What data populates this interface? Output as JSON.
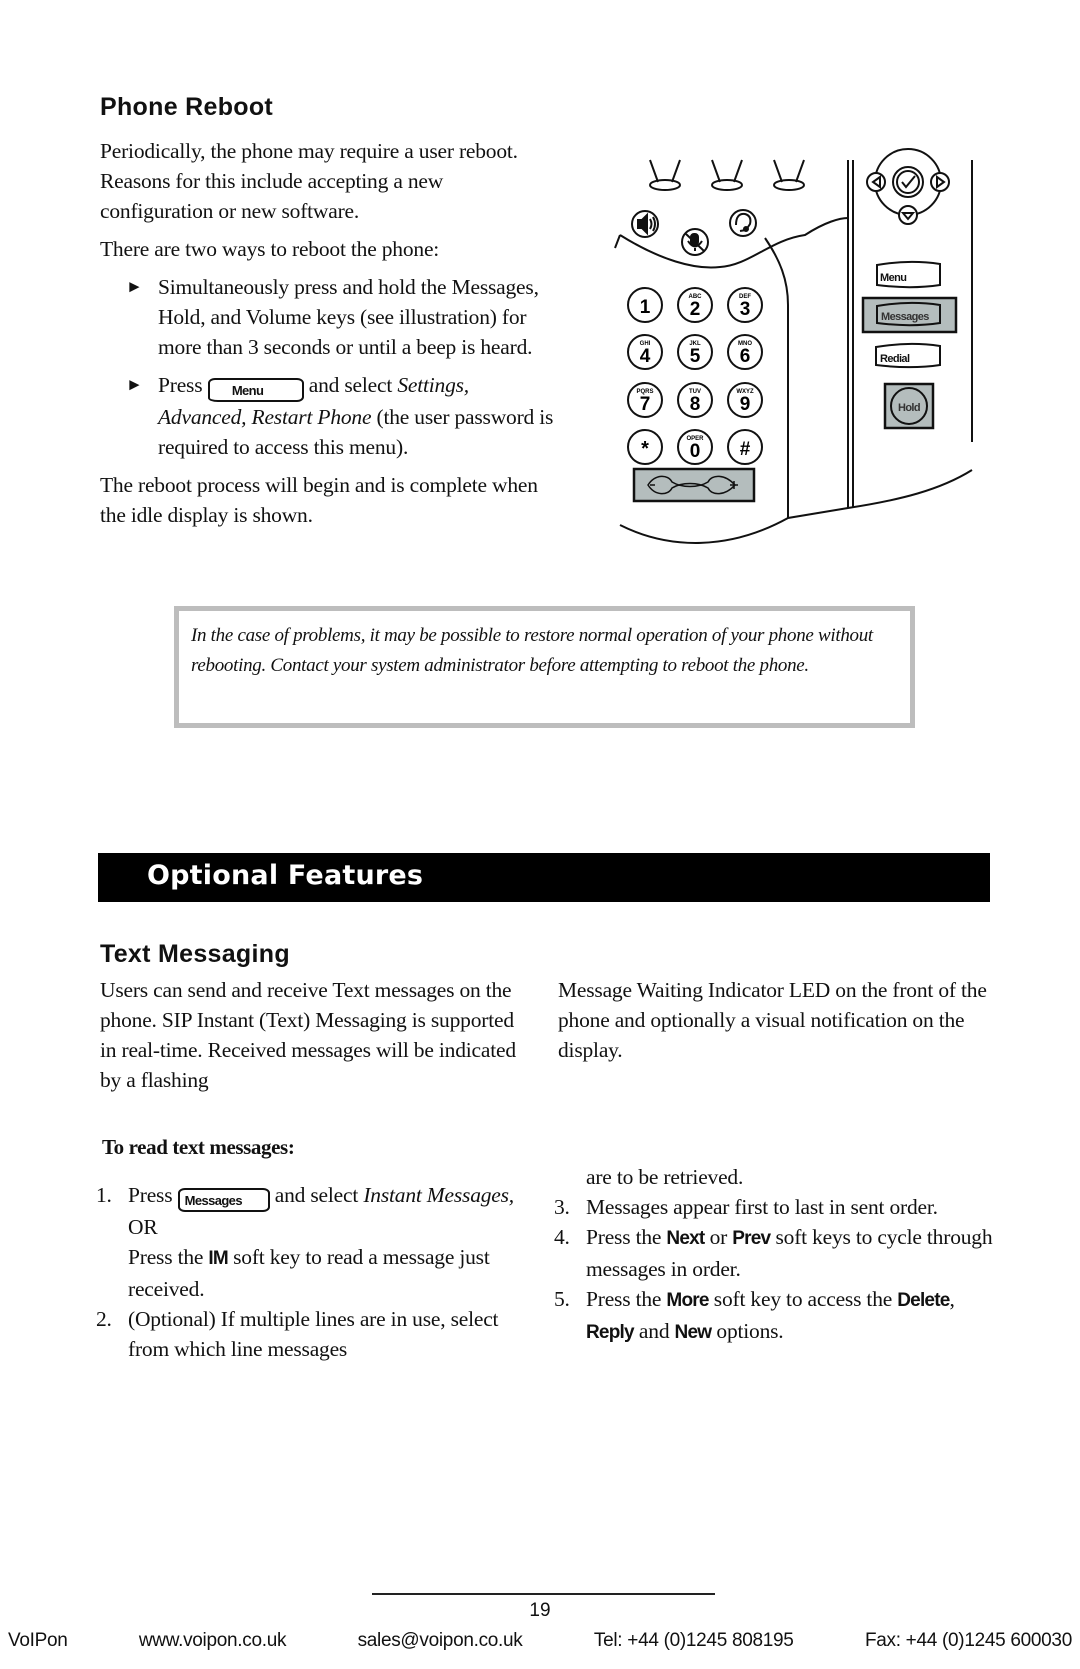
{
  "phone_reboot": {
    "heading": "Phone Reboot",
    "intro_1": "Periodically, the phone may require a user reboot.  Reasons for this include accepting a new configuration or new software.",
    "intro_2": "There are two ways to reboot the phone:",
    "bullet_glyph": "►",
    "bullet_1": "Simultaneously press and hold the Messages, Hold, and Volume keys (see illustration) for more than 3 seconds or until a beep is heard.",
    "bullet_2": {
      "press": "Press",
      "key_label": "Menu",
      "after_key": " and select ",
      "path_italic": "Settings, Advanced, Restart Phone",
      "rest": " (the user password is required to access this menu)."
    },
    "outro": "The reboot process will begin and is complete when the idle display is shown."
  },
  "phone_illustration": {
    "keypad": [
      {
        "digit": "1",
        "letters": ""
      },
      {
        "digit": "2",
        "letters": "ABC"
      },
      {
        "digit": "3",
        "letters": "DEF"
      },
      {
        "digit": "4",
        "letters": "GHI"
      },
      {
        "digit": "5",
        "letters": "JKL"
      },
      {
        "digit": "6",
        "letters": "MNO"
      },
      {
        "digit": "7",
        "letters": "PQRS"
      },
      {
        "digit": "8",
        "letters": "TUV"
      },
      {
        "digit": "9",
        "letters": "WXYZ"
      },
      {
        "digit": "*",
        "letters": ""
      },
      {
        "digit": "0",
        "letters": "OPER"
      },
      {
        "digit": "#",
        "letters": ""
      }
    ],
    "keys": {
      "menu": "Menu",
      "messages": "Messages",
      "redial": "Redial",
      "hold": "Hold"
    },
    "highlight_color": "#b4bdbd"
  },
  "note": {
    "text": "In the case of problems, it may be possible to restore normal operation of your phone without rebooting.  Contact your system administrator before attempting to reboot the phone."
  },
  "section_band": {
    "title": "Optional Features"
  },
  "text_messaging": {
    "heading": "Text Messaging",
    "para_left": "Users can send and receive Text messages on the phone.  SIP Instant (Text) Messaging is supported in real-time.  Received messages will be indicated by a flashing",
    "para_right": "Message Waiting Indicator LED on the front of the phone and optionally a visual notification on the display.",
    "procedure_title": "To read text messages:",
    "steps": {
      "s1": {
        "num": "1.",
        "press": "Press",
        "key_label": "Messages",
        "after_key": " and select ",
        "italic": "Instant Messages,",
        "or": "OR",
        "alt_pre": "Press the ",
        "alt_soft": "IM",
        "alt_post": " soft key to read a message just received."
      },
      "s2": {
        "num": "2.",
        "text": "(Optional)  If multiple lines are in use, select from which line messages are to be retrieved."
      },
      "s3": {
        "num": "3.",
        "text": "Messages appear first to last in sent order."
      },
      "s4": {
        "num": "4.",
        "pre": "Press the ",
        "soft_a": "Next",
        "mid": " or ",
        "soft_b": "Prev",
        "post": " soft keys to cycle through messages in order."
      },
      "s5": {
        "num": "5.",
        "pre": "Press the ",
        "soft_a": "More",
        "mid": " soft key to access the ",
        "soft_b": "Delete",
        "sep": ", ",
        "soft_c": "Reply",
        "and": " and ",
        "soft_d": "New",
        "post": " options."
      }
    }
  },
  "footer": {
    "page_number": "19",
    "company": "VoIPon",
    "website": "www.voipon.co.uk",
    "email": "sales@voipon.co.uk",
    "tel": "Tel: +44 (0)1245 808195",
    "fax": "Fax: +44 (0)1245 600030"
  }
}
